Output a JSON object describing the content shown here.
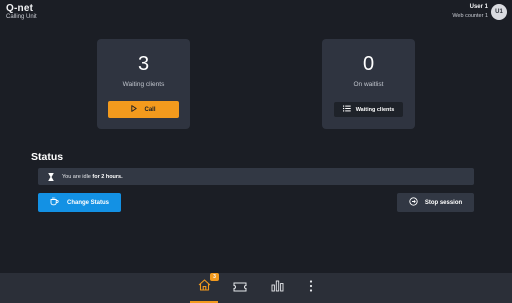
{
  "header": {
    "logo": "Q-net",
    "subtitle": "Calling Unit",
    "user_name": "User 1",
    "user_counter": "Web counter 1",
    "avatar_initials": "U1"
  },
  "cards": {
    "waiting": {
      "count": "3",
      "label": "Waiting clients",
      "button_label": "Call"
    },
    "waitlist": {
      "count": "0",
      "label": "On waitlist",
      "button_label": "Waiting clients"
    }
  },
  "status": {
    "title": "Status",
    "message_prefix": "You are idle",
    "message_bold": "for 2 hours.",
    "change_status_label": "Change Status",
    "stop_session_label": "Stop session"
  },
  "nav": {
    "home_badge": "3",
    "items": [
      "home",
      "tickets",
      "statistics",
      "more"
    ]
  },
  "colors": {
    "accent_orange": "#f39a1d",
    "accent_blue": "#1391e4",
    "background": "#1b1e25",
    "card": "#2f3440"
  }
}
